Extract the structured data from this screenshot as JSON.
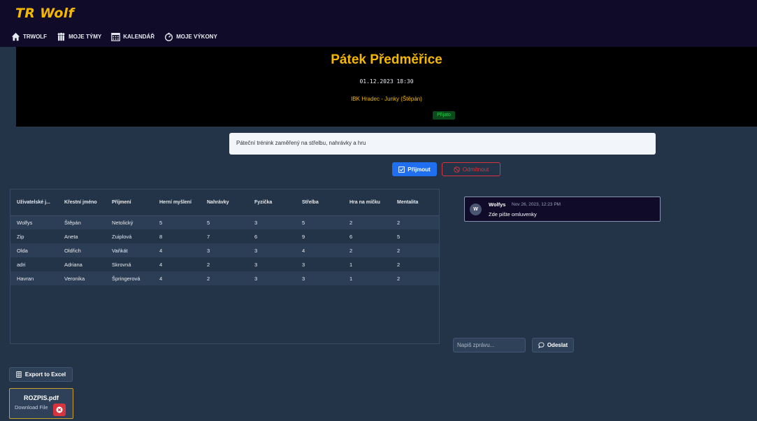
{
  "app": {
    "title": "TR Wolf"
  },
  "nav": [
    {
      "label": "TRWOLF",
      "icon": "house-icon"
    },
    {
      "label": "MOJE TÝMY",
      "icon": "team-icon"
    },
    {
      "label": "KALENDÁŘ",
      "icon": "calendar-icon"
    },
    {
      "label": "MOJE VÝKONY",
      "icon": "performance-icon"
    }
  ],
  "event": {
    "title": "Pátek Předměřice",
    "datetime": "01.12.2023 18:30",
    "teams": "IBK Hradec - Junky (Štěpán)",
    "status": "Přijato"
  },
  "description": "Páteční trénink zaměřený na střelbu, nahrávky a hru",
  "actions": {
    "accept_label": "Přijmout",
    "decline_label": "Odmítnout"
  },
  "table": {
    "headers": [
      "Uživatelské j...",
      "Křestní jméno",
      "Příjmení",
      "Herní myšlení",
      "Nahrávky",
      "Fyzička",
      "Střelba",
      "Hra na míčku",
      "Mentalita"
    ],
    "rows": [
      [
        "Wolfys",
        "Štěpán",
        "Netolický",
        "5",
        "5",
        "3",
        "5",
        "2",
        "2"
      ],
      [
        "Zip",
        "Aneta",
        "Zuiplová",
        "8",
        "7",
        "6",
        "9",
        "6",
        "5"
      ],
      [
        "Olda",
        "Oldřich",
        "Vaňkát",
        "4",
        "3",
        "3",
        "4",
        "2",
        "2"
      ],
      [
        "adri",
        "Adriana",
        "Skrovná",
        "4",
        "2",
        "3",
        "3",
        "1",
        "2"
      ],
      [
        "Havran",
        "Veronika",
        "Špringerová",
        "4",
        "2",
        "3",
        "3",
        "1",
        "2"
      ]
    ]
  },
  "chat": {
    "messages": [
      {
        "avatar": "W",
        "author": "Wolfys",
        "time": "Nov 26, 2023, 12:23 PM",
        "text": "Zde pište omluvenky"
      }
    ],
    "input_placeholder": "Napiš zprávu...",
    "send_label": "Odeslat"
  },
  "export": {
    "label": "Export to Excel"
  },
  "file": {
    "name": "ROZPIS.pdf",
    "download_label": "Download File"
  },
  "colors": {
    "brand": "#f5b800",
    "accept": "#1f6ff0",
    "decline": "#d8343f",
    "status_green": "#27d44b",
    "background": "#233448",
    "topbar": "#0f0b29"
  }
}
